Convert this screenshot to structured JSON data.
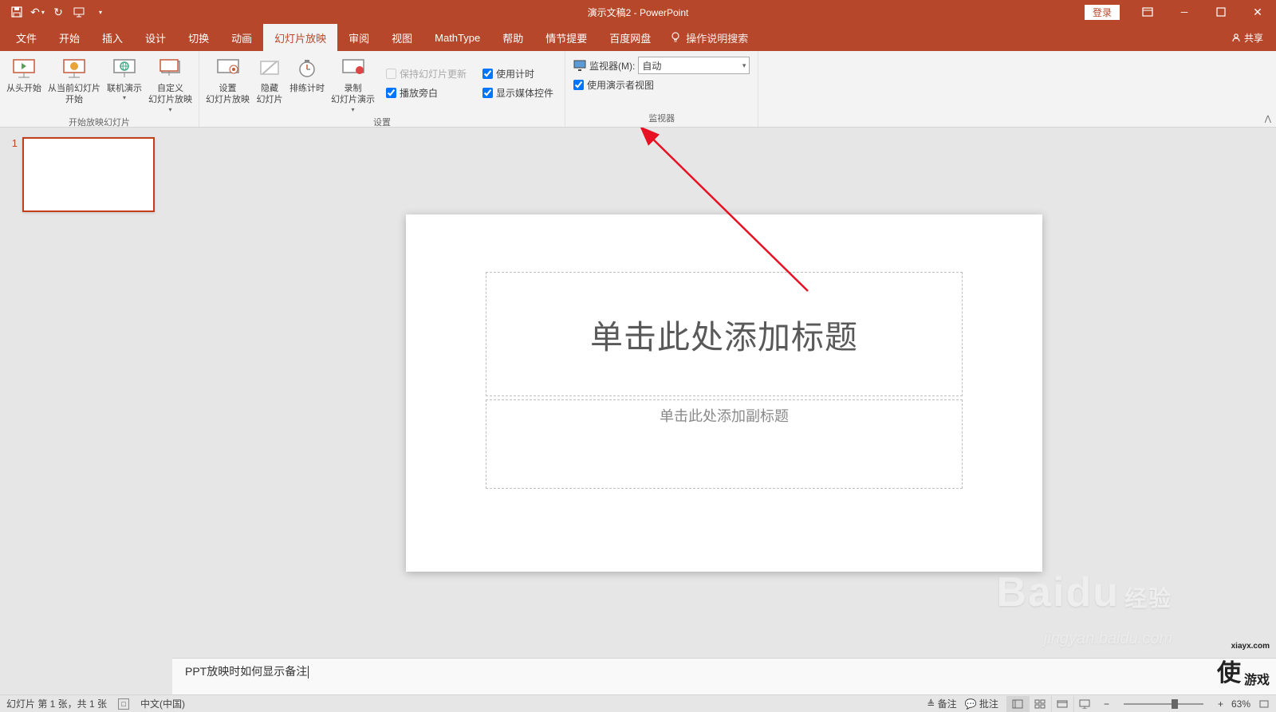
{
  "titlebar": {
    "title": "演示文稿2 - PowerPoint",
    "login": "登录"
  },
  "tabs": {
    "file": "文件",
    "home": "开始",
    "insert": "插入",
    "design": "设计",
    "transitions": "切换",
    "animations": "动画",
    "slideshow": "幻灯片放映",
    "review": "审阅",
    "view": "视图",
    "mathtype": "MathType",
    "help": "帮助",
    "plot": "情节提要",
    "baidu": "百度网盘",
    "tellme": "操作说明搜索",
    "share": "共享"
  },
  "ribbon": {
    "fromBeginning": "从头开始",
    "fromCurrent": "从当前幻灯片\n开始",
    "online": "联机演示",
    "custom": "自定义\n幻灯片放映",
    "group1": "开始放映幻灯片",
    "setup": "设置\n幻灯片放映",
    "hide": "隐藏\n幻灯片",
    "rehearse": "排练计时",
    "record": "录制\n幻灯片演示",
    "keepUpdated": "保持幻灯片更新",
    "narration": "播放旁白",
    "useTimings": "使用计时",
    "mediaControls": "显示媒体控件",
    "group2": "设置",
    "monitorLabel": "监视器(M):",
    "monitorValue": "自动",
    "presenterView": "使用演示者视图",
    "group3": "监视器"
  },
  "slide": {
    "titlePlaceholder": "单击此处添加标题",
    "subtitlePlaceholder": "单击此处添加副标题"
  },
  "thumbs": {
    "slide1": "1"
  },
  "notes": {
    "text": "PPT放映时如何显示备注"
  },
  "status": {
    "slideInfo": "幻灯片 第 1 张，共 1 张",
    "lang": "中文(中国)",
    "notes": "备注",
    "comments": "批注",
    "zoom": "63%"
  },
  "watermark": {
    "baidu": "Baidu",
    "jingyan": "经验",
    "url": "jingyan.baidu.com",
    "xia": "使",
    "game": "游戏",
    "site": "xiayx.com"
  }
}
